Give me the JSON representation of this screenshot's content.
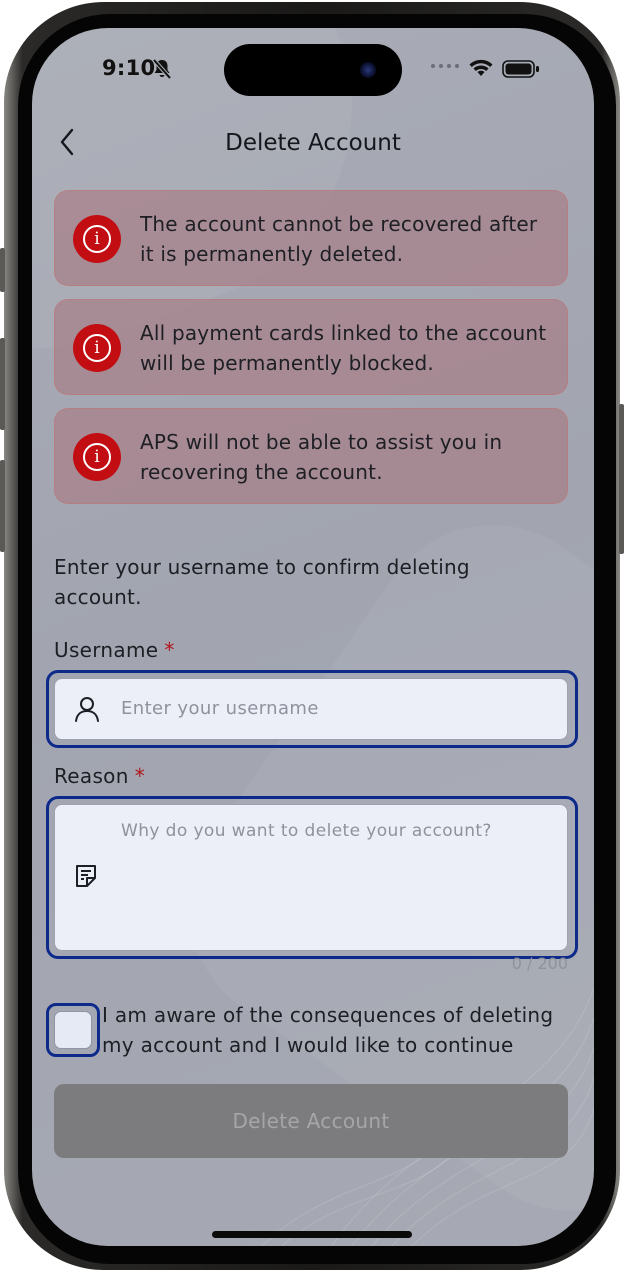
{
  "status_bar": {
    "time": "9:10",
    "icons": [
      "bell-slash-icon",
      "signal-dots-icon",
      "wifi-icon",
      "battery-icon"
    ]
  },
  "header": {
    "title": "Delete Account",
    "back_icon": "chevron-left-icon"
  },
  "warnings": [
    {
      "icon": "info-icon",
      "text": "The account cannot be recovered after it is permanently deleted."
    },
    {
      "icon": "info-icon",
      "text": "All payment cards linked to the account will be permanently blocked."
    },
    {
      "icon": "info-icon",
      "text": "APS will not be able to assist you in recovering the account."
    }
  ],
  "form": {
    "instruction": "Enter your username to confirm deleting account.",
    "username": {
      "label": "Username",
      "required_mark": "*",
      "placeholder": "Enter your username",
      "value": "",
      "icon": "user-icon"
    },
    "reason": {
      "label": "Reason",
      "required_mark": "*",
      "placeholder": "Why do you want to delete your account?",
      "value": "",
      "icon": "note-icon",
      "counter": "0 / 200"
    },
    "consent": {
      "checked": false,
      "text": "I am aware of the consequences of deleting my account and I would like to continue"
    },
    "submit_label": "Delete Account"
  },
  "colors": {
    "warning_icon": "#c20e12",
    "focus_border": "#0d2a8a",
    "required": "#b0141a",
    "button_disabled": "#7c7c7e"
  }
}
